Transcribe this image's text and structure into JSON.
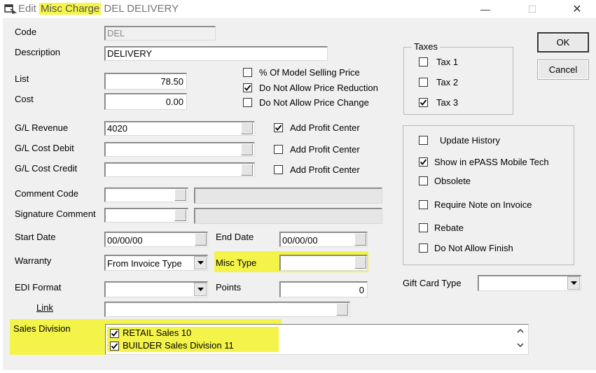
{
  "titlebar": {
    "prefix": "Edit",
    "highlight": "Misc Charge",
    "suffix": "DEL DELIVERY",
    "minimize": "—",
    "maximize": "☐",
    "close": "✕"
  },
  "form": {
    "code": {
      "label": "Code",
      "value": "DEL"
    },
    "description": {
      "label": "Description",
      "value": "DELIVERY"
    },
    "list": {
      "label": "List",
      "value": "78.50"
    },
    "cost": {
      "label": "Cost",
      "value": "0.00"
    },
    "pct_model_price": {
      "label": "% Of Model Selling Price",
      "checked": false
    },
    "no_price_reduction": {
      "label": "Do Not Allow Price Reduction",
      "checked": true
    },
    "no_price_change": {
      "label": "Do Not Allow Price Change",
      "checked": false
    },
    "gl_revenue": {
      "label": "G/L Revenue",
      "value": "4020",
      "profit_label": "Add Profit Center",
      "profit_checked": true
    },
    "gl_cost_debit": {
      "label": "G/L Cost Debit",
      "value": "",
      "profit_label": "Add Profit Center",
      "profit_checked": false
    },
    "gl_cost_credit": {
      "label": "G/L Cost Credit",
      "value": "",
      "profit_label": "Add Profit Center",
      "profit_checked": false
    },
    "comment_code": {
      "label": "Comment Code",
      "value": ""
    },
    "signature_comment": {
      "label": "Signature Comment",
      "value": ""
    },
    "start_date": {
      "label": "Start Date",
      "value": "00/00/00"
    },
    "end_date": {
      "label": "End Date",
      "value": "00/00/00"
    },
    "warranty": {
      "label": "Warranty",
      "value": "From Invoice Type"
    },
    "misc_type": {
      "label": "Misc Type",
      "value": ""
    },
    "edi_format": {
      "label": "EDI Format",
      "value": ""
    },
    "points": {
      "label": "Points",
      "value": "0"
    },
    "link": {
      "label": "Link",
      "value": ""
    },
    "sales_division": {
      "label": "Sales Division",
      "items": [
        {
          "label": "RETAIL Sales 10",
          "checked": true
        },
        {
          "label": "BUILDER Sales Division 11",
          "checked": true
        }
      ]
    }
  },
  "taxes": {
    "title": "Taxes",
    "items": [
      {
        "label": "Tax 1",
        "checked": false
      },
      {
        "label": "Tax 2",
        "checked": false
      },
      {
        "label": "Tax 3",
        "checked": true
      }
    ]
  },
  "options": {
    "update_history": {
      "label": "Update History",
      "checked": false
    },
    "show_mobile": {
      "label": "Show in ePASS Mobile Tech",
      "checked": true
    },
    "obsolete": {
      "label": "Obsolete",
      "checked": false
    },
    "require_note": {
      "label": "Require Note on Invoice",
      "checked": false
    },
    "rebate": {
      "label": "Rebate",
      "checked": false
    },
    "no_finish": {
      "label": "Do Not Allow Finish",
      "checked": false
    }
  },
  "gift_card": {
    "label": "Gift Card Type",
    "value": ""
  },
  "buttons": {
    "ok": "OK",
    "cancel": "Cancel"
  },
  "colors": {
    "highlight": "#f3f34a",
    "window_bg": "#f0f0f0"
  }
}
